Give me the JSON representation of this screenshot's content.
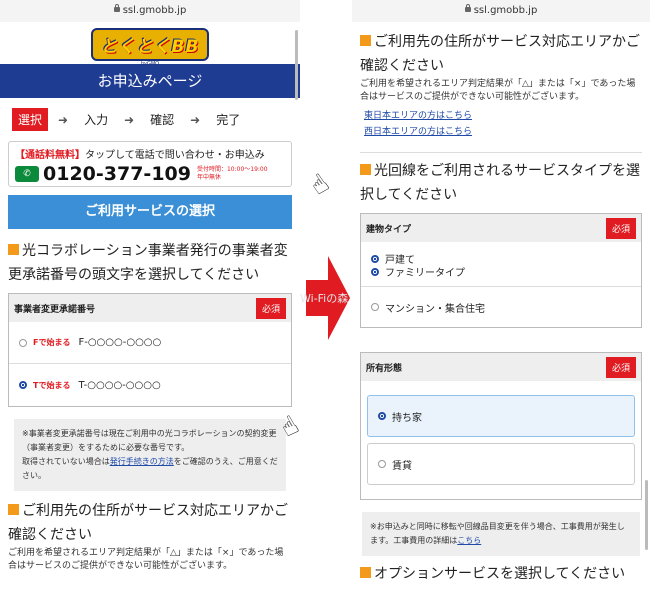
{
  "url": "ssl.gmobb.jp",
  "logo": {
    "text": "とくとくBB",
    "sub": "byGMO"
  },
  "left": {
    "banner": "お申込みページ",
    "steps": [
      "選択",
      "入力",
      "確認",
      "完了"
    ],
    "call": {
      "badge": "【通話料無料】",
      "text": "タップして電話で問い合わせ・お申込み",
      "tel": "0120-377-109",
      "hours1": "受付時間：10:00〜19:00",
      "hours2": "年中無休"
    },
    "service_btn": "ご利用サービスの選択",
    "section1_title": "光コラボレーション事業者発行の事業者変更承諾番号の頭文字を選択してください",
    "card": {
      "header": "事業者変更承諾番号",
      "required": "必須",
      "options": [
        {
          "label": "Fで始まる",
          "value": "F-○○○○-○○○○",
          "selected": false
        },
        {
          "label": "Tで始まる",
          "value": "T-○○○○-○○○○",
          "selected": true
        }
      ]
    },
    "note": {
      "line1": "※事業者変更承諾番号は現在ご利用中の光コラボレーションの契約変更（事業者変更）をするために必要な番号です。",
      "pre": "取得されていない場合は",
      "link": "発行手続きの方法",
      "post": "をご確認のうえ、ご用意ください。"
    },
    "section2_title": "ご利用先の住所がサービス対応エリアかご確認ください",
    "section2_sub": "ご利用を希望されるエリア判定結果が「△」または「×」であった場合はサービスのご提供ができない可能性がございます。"
  },
  "right": {
    "section_area_title": "ご利用先の住所がサービス対応エリアかご確認ください",
    "section_area_sub": "ご利用を希望されるエリア判定結果が「△」または「×」であった場合はサービスのご提供ができない可能性がございます。",
    "link_east": "東日本エリアの方はこちら",
    "link_west": "西日本エリアの方はこちら",
    "section_type_title": "光回線をご利用されるサービスタイプを選択してください",
    "building": {
      "header": "建物タイプ",
      "required": "必須",
      "options": [
        {
          "label": "戸建て",
          "selected": true
        },
        {
          "label": "ファミリータイプ",
          "selected": true
        },
        {
          "label": "マンション・集合住宅",
          "selected": false
        }
      ]
    },
    "ownership": {
      "header": "所有形態",
      "required": "必須",
      "options": [
        {
          "label": "持ち家",
          "selected": true
        },
        {
          "label": "賃貸",
          "selected": false
        }
      ]
    },
    "note": {
      "line": "※お申込みと同時に移転や回線品目変更を伴う場合、工事費用が発生します。工事費用の詳細は",
      "link": "こちら"
    },
    "cut_title": "オプションサービスを選択してください"
  },
  "watermark": "Wi-Fiの森",
  "colors": {
    "accent": "#e11b22",
    "navy": "#1f3c93",
    "blue": "#3a8fd6",
    "orange": "#f39a1b"
  }
}
